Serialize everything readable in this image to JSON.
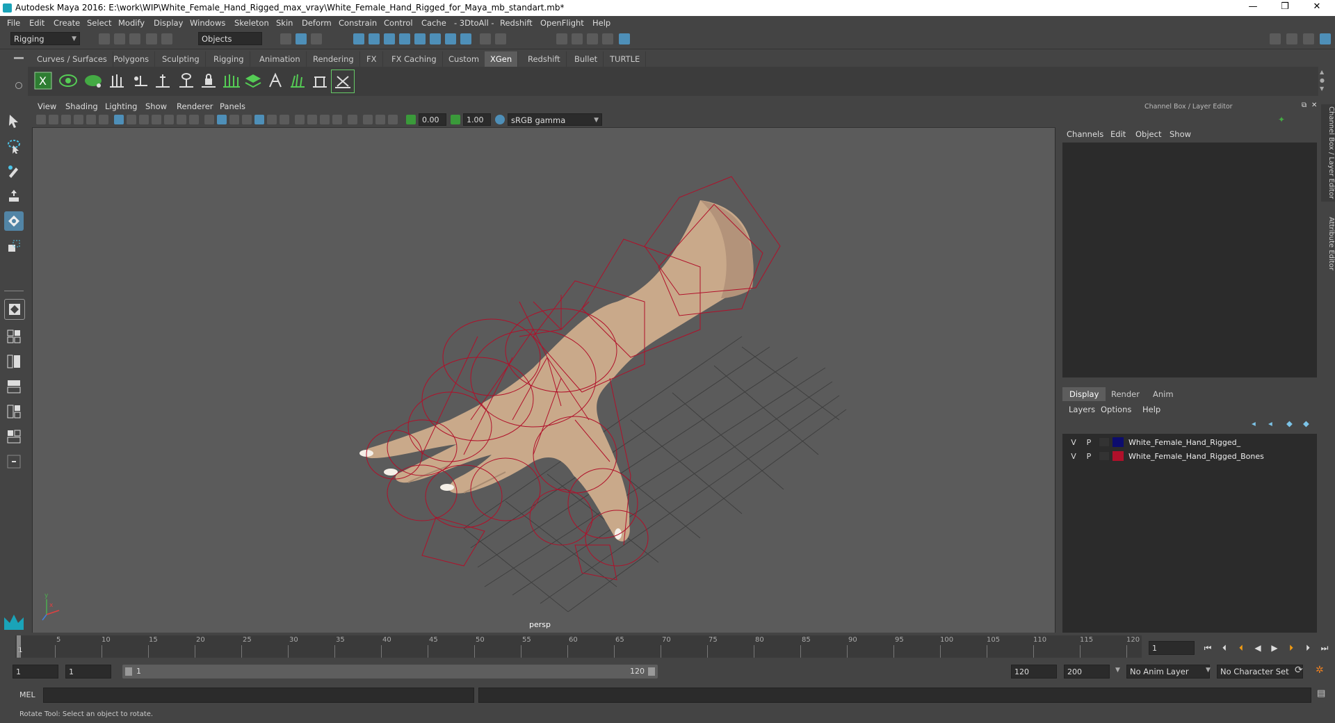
{
  "window": {
    "title": "Autodesk Maya 2016: E:\\work\\WIP\\White_Female_Hand_Rigged_max_vray\\White_Female_Hand_Rigged_for_Maya_mb_standart.mb*",
    "minimize": "—",
    "restore": "❒",
    "close": "✕"
  },
  "menubar": [
    "File",
    "Edit",
    "Create",
    "Select",
    "Modify",
    "Display",
    "Windows",
    "Skeleton",
    "Skin",
    "Deform",
    "Constrain",
    "Control",
    "Cache",
    "- 3DtoAll -",
    "Redshift",
    "OpenFlight",
    "Help"
  ],
  "statusline": {
    "menuset": "Rigging",
    "selection_mode": "Objects"
  },
  "shelf_tabs": [
    "Curves / Surfaces",
    "Polygons",
    "Sculpting",
    "Rigging",
    "Animation",
    "Rendering",
    "FX",
    "FX Caching",
    "Custom",
    "XGen",
    "Redshift",
    "Bullet",
    "TURTLE"
  ],
  "shelf_active_tab": "XGen",
  "viewport": {
    "menus": [
      "View",
      "Shading",
      "Lighting",
      "Show",
      "Renderer",
      "Panels"
    ],
    "exposure": "0.00",
    "gamma": "1.00",
    "color_space": "sRGB gamma",
    "camera_label": "persp",
    "axis_x": "x",
    "axis_y": "y"
  },
  "channel_box": {
    "title": "Channel Box / Layer Editor",
    "menus": [
      "Channels",
      "Edit",
      "Object",
      "Show"
    ]
  },
  "side_tabs": {
    "channel": "Channel Box / Layer Editor",
    "attribute": "Attribute Editor"
  },
  "layer_editor": {
    "tabs": [
      "Display",
      "Render",
      "Anim"
    ],
    "active_tab": "Display",
    "menus": [
      "Layers",
      "Options",
      "Help"
    ],
    "layers": [
      {
        "v": "V",
        "p": "P",
        "name": "White_Female_Hand_Rigged_",
        "color": "#0c0c6e"
      },
      {
        "v": "V",
        "p": "P",
        "name": "White_Female_Hand_Rigged_Bones",
        "color": "#b0102a"
      }
    ]
  },
  "timeline": {
    "current_frame": "1",
    "ticks": [
      "1",
      "5",
      "10",
      "15",
      "20",
      "25",
      "30",
      "35",
      "40",
      "45",
      "50",
      "55",
      "60",
      "65",
      "70",
      "75",
      "80",
      "85",
      "90",
      "95",
      "100",
      "105",
      "110",
      "115",
      "120"
    ],
    "frame_field": "1"
  },
  "range": {
    "start": "1",
    "playback_start": "1",
    "slider_start": "1",
    "slider_end": "120",
    "playback_end": "120",
    "end": "200",
    "anim_layer": "No Anim Layer",
    "character_set": "No Character Set"
  },
  "cmdline": {
    "label": "MEL"
  },
  "helpline": {
    "text": "Rotate Tool: Select an object to rotate."
  }
}
